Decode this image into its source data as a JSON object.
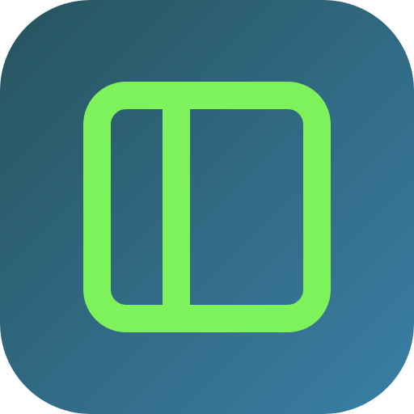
{
  "app_icon": {
    "icon_name": "sidebar-panel-icon",
    "colors": {
      "background_top_left": "#27535e",
      "background_bottom_right": "#3a7fa6",
      "glyph_stroke": "#7ef25a"
    }
  }
}
